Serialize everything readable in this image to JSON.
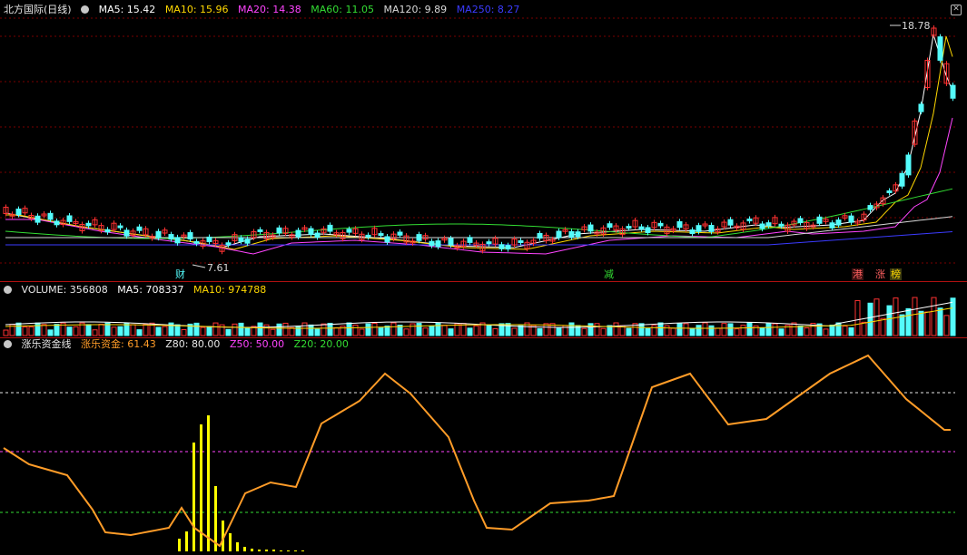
{
  "main": {
    "title": "北方国际(日线)",
    "ma": [
      {
        "label": "MA5: 15.42",
        "color": "#ffffff"
      },
      {
        "label": "MA10: 15.96",
        "color": "#ffd800"
      },
      {
        "label": "MA20: 14.38",
        "color": "#ff44ff"
      },
      {
        "label": "MA60: 11.05",
        "color": "#33dd33"
      },
      {
        "label": "MA120: 9.89",
        "color": "#d8d8d8"
      },
      {
        "label": "MA250: 8.27",
        "color": "#3b3bff"
      }
    ],
    "high_label": "18.78",
    "low_label": "7.61",
    "markers": [
      "财",
      "减",
      "港",
      "涨",
      "榜"
    ]
  },
  "volume": {
    "title": "VOLUME: 356808",
    "ma5": "MA5: 708337",
    "ma10": "MA10: 974788"
  },
  "indicator": {
    "title": "涨乐资金线",
    "fund": "涨乐资金: 61.43",
    "z80": "Z80: 80.00",
    "z50": "Z50: 50.00",
    "z20": "Z20: 20.00"
  },
  "colors": {
    "up": "#ff3232",
    "down": "#54fcfc",
    "grid": "#8b0000",
    "fund": "#ff9c28",
    "bars": "#ffff00"
  }
}
